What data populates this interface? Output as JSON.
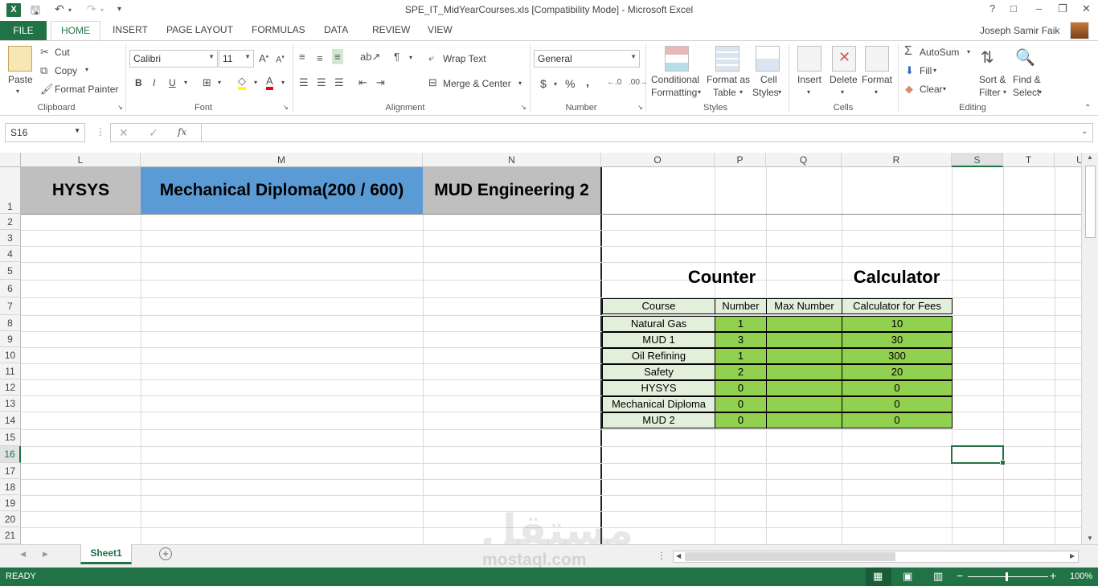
{
  "window": {
    "title": "SPE_IT_MidYearCourses.xls  [Compatibility Mode] - Microsoft Excel",
    "controls": [
      "?",
      "□",
      "–",
      "❐",
      "✕"
    ]
  },
  "ribbon_tabs": [
    "FILE",
    "HOME",
    "INSERT",
    "PAGE LAYOUT",
    "FORMULAS",
    "DATA",
    "REVIEW",
    "VIEW"
  ],
  "user": "Joseph Samir Faik",
  "clipboard": {
    "paste": "Paste",
    "cut": "Cut",
    "copy": "Copy",
    "format_painter": "Format Painter",
    "label": "Clipboard"
  },
  "font": {
    "name": "Calibri",
    "size": "11",
    "label": "Font",
    "bold": "B",
    "italic": "I",
    "underline": "U"
  },
  "alignment": {
    "wrap": "Wrap Text",
    "merge": "Merge & Center",
    "label": "Alignment"
  },
  "number": {
    "format": "General",
    "label": "Number",
    "currency": "$",
    "percent": "%",
    "comma": ","
  },
  "styles": {
    "conditional": [
      "Conditional",
      "Formatting"
    ],
    "format_table": [
      "Format as",
      "Table"
    ],
    "cell_styles": [
      "Cell",
      "Styles"
    ],
    "label": "Styles"
  },
  "cells": {
    "insert": "Insert",
    "delete": "Delete",
    "format": "Format",
    "label": "Cells"
  },
  "editing": {
    "autosum": "AutoSum",
    "fill": "Fill",
    "clear": "Clear",
    "sort": [
      "Sort &",
      "Filter"
    ],
    "find": [
      "Find &",
      "Select"
    ],
    "label": "Editing"
  },
  "formula_bar": {
    "name_box": "S16",
    "fx": "fx",
    "value": ""
  },
  "columns": [
    "L",
    "M",
    "N",
    "O",
    "P",
    "Q",
    "R",
    "S",
    "T",
    "U"
  ],
  "rows": [
    "1",
    "2",
    "3",
    "4",
    "5",
    "6",
    "7",
    "8",
    "9",
    "10",
    "11",
    "12",
    "13",
    "14",
    "15",
    "16",
    "17",
    "18",
    "19",
    "20",
    "21"
  ],
  "headers": {
    "l1": "HYSYS",
    "m1": "Mechanical Diploma(200 / 600)",
    "n1": "MUD Engineering 2",
    "counter": "Counter",
    "calculator": "Calculator"
  },
  "table": {
    "columns": [
      "Course",
      "Number",
      "Max Number",
      "Calculator for Fees"
    ],
    "rows": [
      [
        "Natural Gas",
        "1",
        "",
        "10"
      ],
      [
        "MUD 1",
        "3",
        "",
        "30"
      ],
      [
        "Oil Refining",
        "1",
        "",
        "300"
      ],
      [
        "Safety",
        "2",
        "",
        "20"
      ],
      [
        "HYSYS",
        "0",
        "",
        "0"
      ],
      [
        "Mechanical Diploma",
        "0",
        "",
        "0"
      ],
      [
        "MUD 2",
        "0",
        "",
        "0"
      ]
    ]
  },
  "colors": {
    "excel_green": "#217346",
    "header_gray": "#bfbfbf",
    "header_blue": "#5b9bd5",
    "table_light": "#e2efda",
    "table_green": "#92d050"
  },
  "sheet_tab": "Sheet1",
  "status": {
    "mode": "READY",
    "zoom": "100%"
  },
  "watermark": {
    "arabic": "مستقل",
    "latin": "mostaql.com"
  }
}
